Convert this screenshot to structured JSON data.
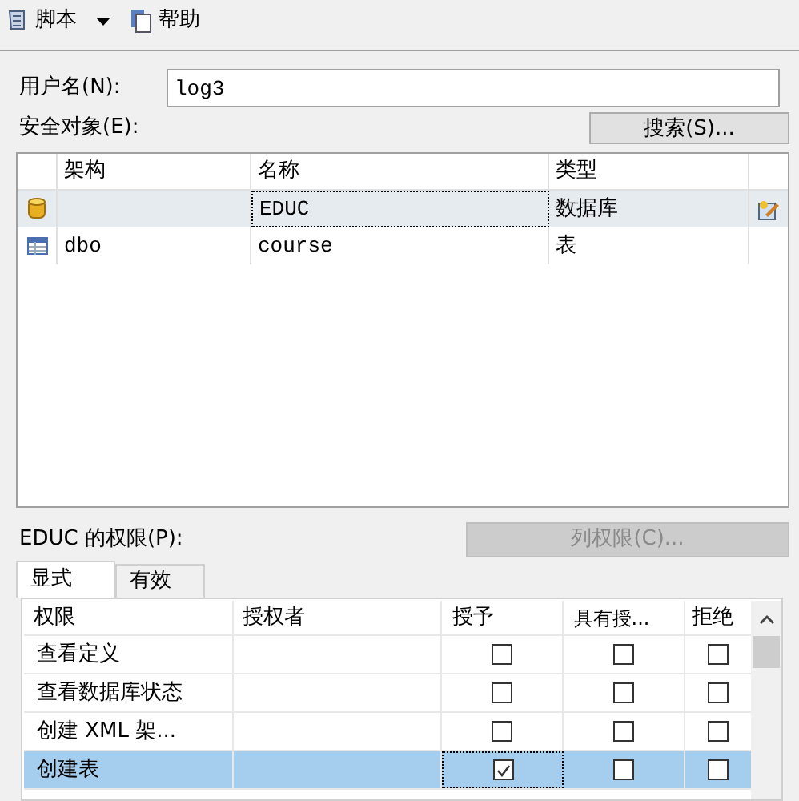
{
  "toolbar": [
    {
      "label": "脚本",
      "kind": "script",
      "dropdown": true
    },
    {
      "label": "帮助",
      "kind": "help",
      "dropdown": false
    }
  ],
  "username": {
    "label": "用户名(N):",
    "value": "log3"
  },
  "securables": {
    "label": "安全对象(E):",
    "search_button": "搜索(S)...",
    "columns": [
      "架构",
      "名称",
      "类型"
    ],
    "rows": [
      {
        "kind": "database",
        "schema": "",
        "name": "EDUC",
        "type": "数据库",
        "selected": true
      },
      {
        "kind": "table",
        "schema": "dbo",
        "name": "course",
        "type": "表",
        "selected": false
      }
    ]
  },
  "permissions": {
    "label": "EDUC 的权限(P):",
    "column_button": {
      "label": "列权限(C)...",
      "disabled": true
    },
    "tabs": [
      {
        "label": "显式",
        "selected": true
      },
      {
        "label": "有效",
        "selected": false
      }
    ],
    "columns": [
      "权限",
      "授权者",
      "授予",
      "具有授...",
      "拒绝"
    ],
    "rows": [
      {
        "name": "查看定义",
        "grantor": "",
        "grant": false,
        "with_grant": false,
        "deny": false,
        "selected": false
      },
      {
        "name": "查看数据库状态",
        "grantor": "",
        "grant": false,
        "with_grant": false,
        "deny": false,
        "selected": false
      },
      {
        "name": "创建 XML 架...",
        "grantor": "",
        "grant": false,
        "with_grant": false,
        "deny": false,
        "selected": false
      },
      {
        "name": "创建表",
        "grantor": "",
        "grant": true,
        "with_grant": false,
        "deny": false,
        "selected": true
      }
    ]
  }
}
